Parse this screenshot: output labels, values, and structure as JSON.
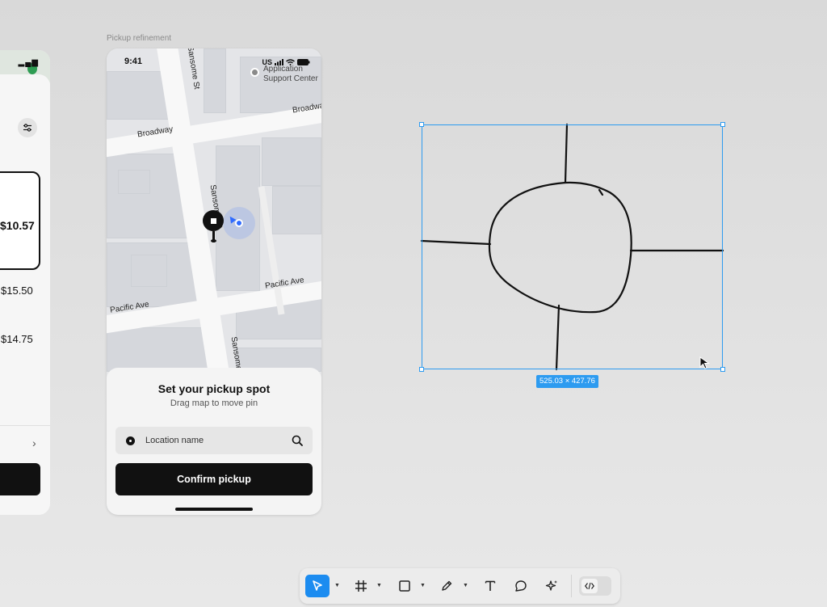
{
  "frame_label": "Pickup refinement",
  "status_bar": {
    "time": "9:41",
    "carrier": "US"
  },
  "map": {
    "poi": "Application Support Center",
    "streets": [
      "Sansome St",
      "Broadway",
      "Sansome St",
      "Pacific Ave",
      "Pacific Ave",
      "Sansome St",
      "Broadway"
    ]
  },
  "sheet": {
    "title": "Set your pickup spot",
    "subtitle": "Drag map to move pin",
    "location_placeholder": "Location name",
    "confirm_label": "Confirm pickup"
  },
  "left_frame": {
    "prices": [
      "$10.57",
      "$15.50",
      "$14.75"
    ]
  },
  "selection": {
    "dimensions": "525.03 × 427.76"
  },
  "toolbar": {
    "tools": [
      "move-tool",
      "frame-tool",
      "shape-tool",
      "pen-tool",
      "text-tool",
      "comment-tool",
      "actions-tool",
      "dev-mode-tool"
    ],
    "accent": "#1c8cf0"
  }
}
